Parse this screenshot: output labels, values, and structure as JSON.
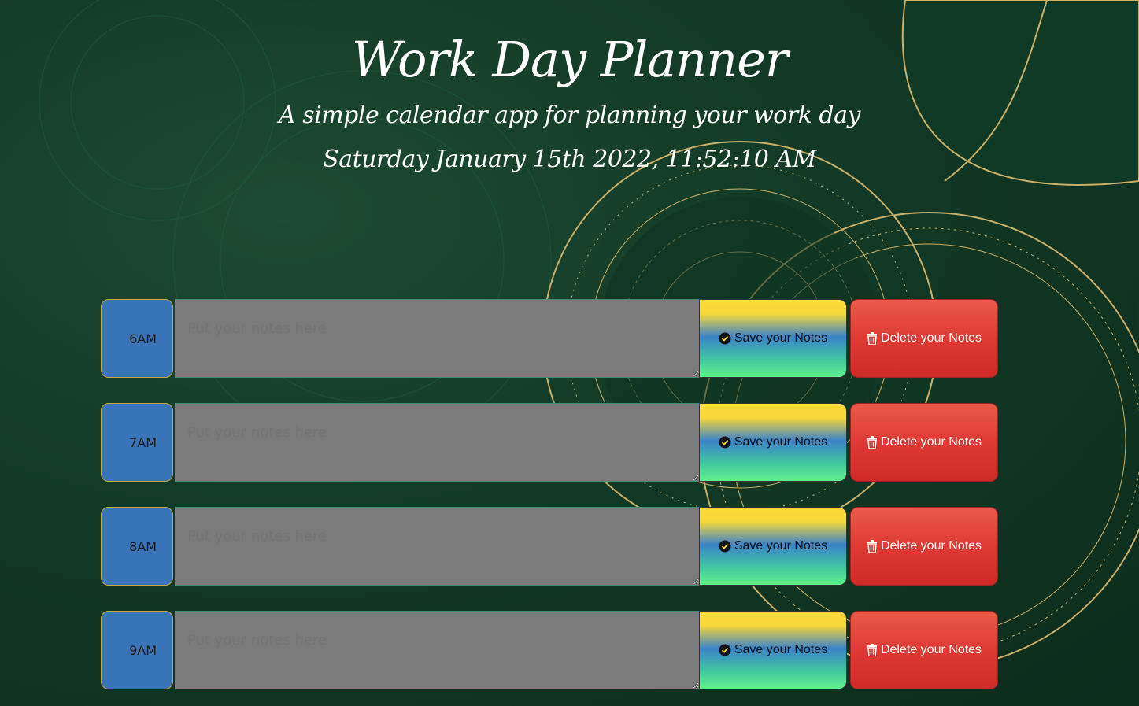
{
  "header": {
    "title": "Work Day Planner",
    "subtitle": "A simple calendar app for planning your work day",
    "datetime": "Saturday January 15th 2022, 11:52:10 AM"
  },
  "notes_placeholder": "Put your notes here",
  "save_label": "Save your Notes",
  "delete_label": "Delete your Notes",
  "hours": [
    {
      "label": "6AM",
      "note": ""
    },
    {
      "label": "7AM",
      "note": ""
    },
    {
      "label": "8AM",
      "note": ""
    },
    {
      "label": "9AM",
      "note": ""
    }
  ],
  "icons": {
    "save": "check-circle-icon",
    "delete": "trash-icon"
  },
  "colors": {
    "hour_block": "#3a74b8",
    "notes_bg": "#7b7b7b",
    "delete": "#df3a34",
    "save_top": "#fbd935",
    "save_bottom": "#5ff08a"
  }
}
